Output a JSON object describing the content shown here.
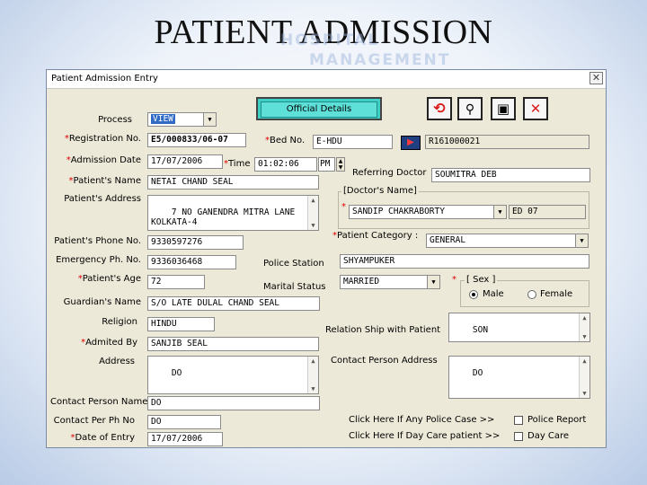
{
  "slide": {
    "title": "PATIENT ADMISSION",
    "watermark_line1": "HOSPITAL",
    "watermark_line2": "MANAGEMENT"
  },
  "window": {
    "title": "Patient Admission Entry",
    "close_glyph": "✕"
  },
  "toolbar": {
    "official_details_label": "Official Details",
    "buttons": [
      {
        "name": "refresh-icon",
        "glyph": "⟲",
        "color": "#d91c1c"
      },
      {
        "name": "search-icon",
        "glyph": "🔍",
        "color": "#222"
      },
      {
        "name": "save-icon",
        "glyph": "▣",
        "color": "#1c1c1c"
      },
      {
        "name": "close-icon",
        "glyph": "✕",
        "color": "#d91c1c"
      }
    ]
  },
  "form": {
    "process": {
      "label": "Process",
      "value": "VIEW"
    },
    "registration_no": {
      "label": "Registration No.",
      "value": "E5/000833/06-07"
    },
    "bed_no": {
      "label": "Bed No.",
      "value": "E-HDU",
      "code": "R161000021"
    },
    "admission_date": {
      "label": "Admission Date",
      "value": "17/07/2006"
    },
    "time": {
      "label": "Time",
      "value": "01:02:06",
      "ampm": "PM"
    },
    "referring_doctor": {
      "label": "Referring Doctor",
      "value": "SOUMITRA DEB"
    },
    "patient_name": {
      "label": "Patient's Name",
      "value": "NETAI CHAND SEAL"
    },
    "patient_address": {
      "label": "Patient's Address",
      "value": "7 NO GANENDRA MITRA LANE\nKOLKATA-4"
    },
    "doctor_name": {
      "label": "Doctor's Name",
      "value": "SANDIP CHAKRABORTY",
      "code": "ED 07"
    },
    "patient_phone": {
      "label": "Patient's Phone No.",
      "value": "9330597276"
    },
    "patient_category": {
      "label": "Patient Category :",
      "value": "GENERAL"
    },
    "emergency_ph": {
      "label": "Emergency Ph. No.",
      "value": "9336036468"
    },
    "police_station": {
      "label": "Police Station",
      "value": "SHYAMPUKER"
    },
    "patient_age": {
      "label": "Patient's Age",
      "value": "72"
    },
    "marital_status": {
      "label": "Marital Status",
      "value": "MARRIED"
    },
    "sex": {
      "label": "Sex",
      "options": [
        "Male",
        "Female"
      ],
      "selected": "Male"
    },
    "guardian_name": {
      "label": "Guardian's Name",
      "value": "S/O LATE DULAL CHAND SEAL"
    },
    "religion": {
      "label": "Religion",
      "value": "HINDU"
    },
    "relation_ship": {
      "label": "Relation Ship with Patient",
      "value": "SON"
    },
    "admitted_by": {
      "label": "Admited By",
      "value": "SANJIB SEAL"
    },
    "address": {
      "label": "Address",
      "value": "DO"
    },
    "contact_person_address": {
      "label": "Contact Person Address",
      "value": "DO"
    },
    "contact_person_name": {
      "label": "Contact Person Name",
      "value": "DO"
    },
    "contact_per_ph": {
      "label": "Contact Per Ph No",
      "value": "DO"
    },
    "date_of_entry": {
      "label": "Date of Entry",
      "value": "17/07/2006"
    },
    "police_case": {
      "prompt": "Click Here If Any Police Case >>",
      "check_label": "Police Report"
    },
    "day_care": {
      "prompt": "Click Here If Day Care patient >>",
      "check_label": "Day Care"
    }
  }
}
